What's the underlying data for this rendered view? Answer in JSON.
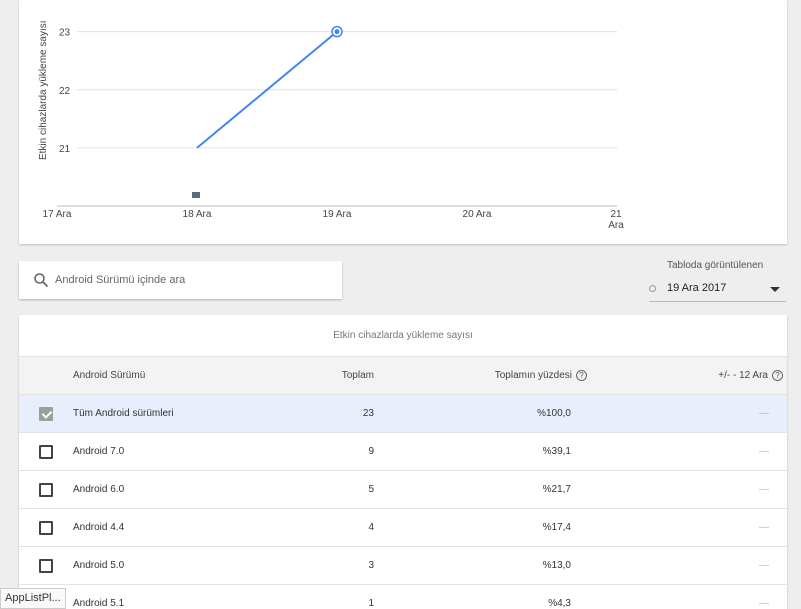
{
  "chart": {
    "ylabel": "Etkin cihazlarda yükleme sayısı",
    "y_ticks": [
      "21",
      "22",
      "23"
    ],
    "x_ticks": [
      "17 Ara",
      "18 Ara",
      "19 Ara",
      "20 Ara",
      "21 Ara"
    ],
    "line_color": "#4285f4"
  },
  "chart_data": {
    "type": "line",
    "x": [
      "17 Ara",
      "18 Ara",
      "19 Ara",
      "20 Ara",
      "21 Ara"
    ],
    "series": [
      {
        "values": [
          null,
          21,
          23,
          null,
          null
        ]
      }
    ],
    "ylabel": "Etkin cihazlarda yükleme sayısı",
    "xlabel": "",
    "ylim": [
      20,
      23.2
    ],
    "grid": true,
    "annotation_markers": [
      "18 Ara"
    ]
  },
  "search": {
    "placeholder": "Android Sürümü içinde ara"
  },
  "date_selector": {
    "label": "Tabloda görüntülenen",
    "value": "19 Ara 2017"
  },
  "table": {
    "title": "Etkin cihazlarda yükleme sayısı",
    "headers": {
      "name": "Android Sürümü",
      "total": "Toplam",
      "pct": "Toplamın yüzdesi",
      "delta": "+/- - 12 Ara"
    },
    "help_glyph": "?",
    "rows": [
      {
        "name": "Tüm Android sürümleri",
        "total": "23",
        "pct": "%100,0",
        "delta": "—",
        "checked": true
      },
      {
        "name": "Android 7.0",
        "total": "9",
        "pct": "%39,1",
        "delta": "—",
        "checked": false
      },
      {
        "name": "Android 6.0",
        "total": "5",
        "pct": "%21,7",
        "delta": "—",
        "checked": false
      },
      {
        "name": "Android 4.4",
        "total": "4",
        "pct": "%17,4",
        "delta": "—",
        "checked": false
      },
      {
        "name": "Android 5.0",
        "total": "3",
        "pct": "%13,0",
        "delta": "—",
        "checked": false
      },
      {
        "name": "Android 5.1",
        "total": "1",
        "pct": "%4,3",
        "delta": "—",
        "checked": false
      }
    ]
  },
  "tooltip": {
    "text": "AppListPl..."
  }
}
